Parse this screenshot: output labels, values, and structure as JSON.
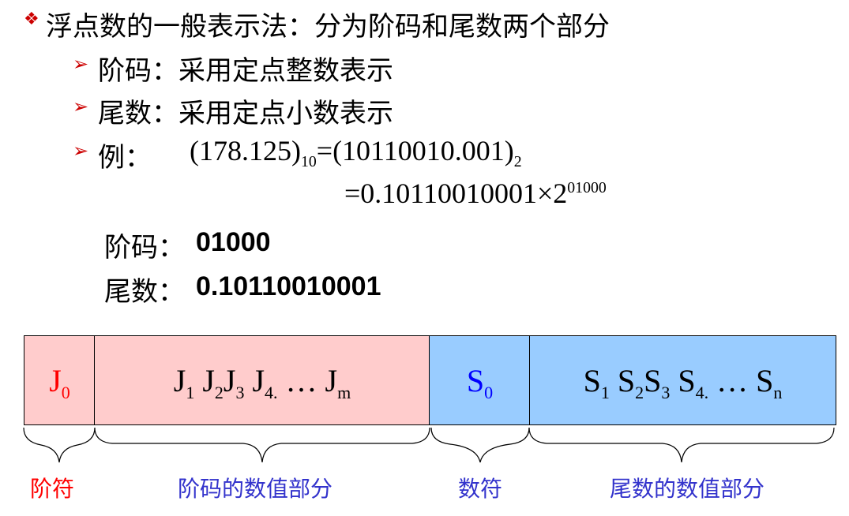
{
  "heading": {
    "bullet_icon": "diamond-bullet-icon",
    "text": "浮点数的一般表示法：分为阶码和尾数两个部分"
  },
  "subitems": [
    {
      "icon": "arrow-bullet-icon",
      "text": "阶码：采用定点整数表示"
    },
    {
      "icon": "arrow-bullet-icon",
      "text": "尾数：采用定点小数表示"
    },
    {
      "icon": "arrow-bullet-icon",
      "text": "例："
    }
  ],
  "example": {
    "line1_a": "(178.125)",
    "line1_sub1": "10",
    "line1_b": "=(10110010.001)",
    "line1_sub2": "2",
    "line2_a": "=0.10110010001",
    "line2_times": "×",
    "line2_base": "2",
    "line2_exp": "01000"
  },
  "result": {
    "exponent_label": "阶码：",
    "exponent_value": "01000",
    "mantissa_label": "尾数：",
    "mantissa_value": "0.10110010001"
  },
  "diagram": {
    "boxes": {
      "j0": {
        "main": "J",
        "sub": "0",
        "color": "#ff0000",
        "bg": "#ffcccc"
      },
      "jrest": {
        "bg": "#ffcccc"
      },
      "s0": {
        "main": "S",
        "sub": "0",
        "color": "#0000ff",
        "bg": "#99ccff"
      },
      "srest": {
        "bg": "#99ccff"
      }
    },
    "labels": {
      "exponent_sign": {
        "text": "阶符",
        "color": "#ff0000"
      },
      "exponent_value": {
        "text": "阶码的数值部分",
        "color": "#3333cc"
      },
      "mantissa_sign": {
        "text": "数符",
        "color": "#3333cc"
      },
      "mantissa_value": {
        "text": "尾数的数值部分",
        "color": "#3333cc"
      }
    }
  }
}
